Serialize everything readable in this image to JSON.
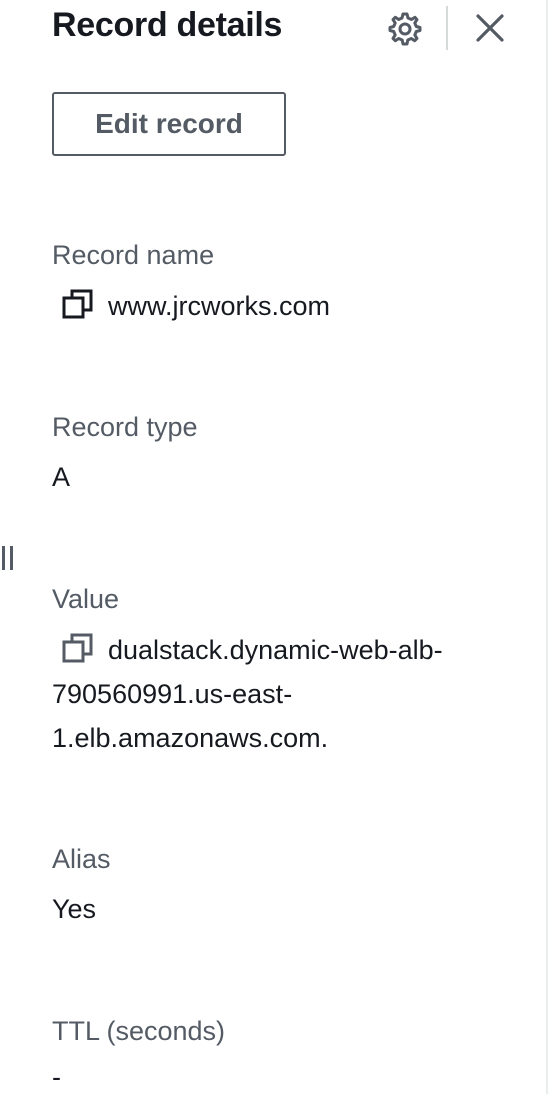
{
  "header": {
    "title": "Record details",
    "settings_icon": "gear-icon",
    "close_icon": "close-icon"
  },
  "actions": {
    "edit_label": "Edit record"
  },
  "fields": {
    "record_name": {
      "label": "Record name",
      "value": "www.jrcworks.com",
      "icon": "copy-icon"
    },
    "record_type": {
      "label": "Record type",
      "value": "A"
    },
    "value": {
      "label": "Value",
      "value": "dualstack.dynamic-web-alb-790560991.us-east-1.elb.amazonaws.com.",
      "icon": "copy-icon"
    },
    "alias": {
      "label": "Alias",
      "value": "Yes"
    },
    "ttl": {
      "label": "TTL (seconds)",
      "value": "-"
    }
  },
  "colors": {
    "text_primary": "#16191f",
    "text_secondary": "#545b64",
    "divider": "#d5dbdb"
  }
}
